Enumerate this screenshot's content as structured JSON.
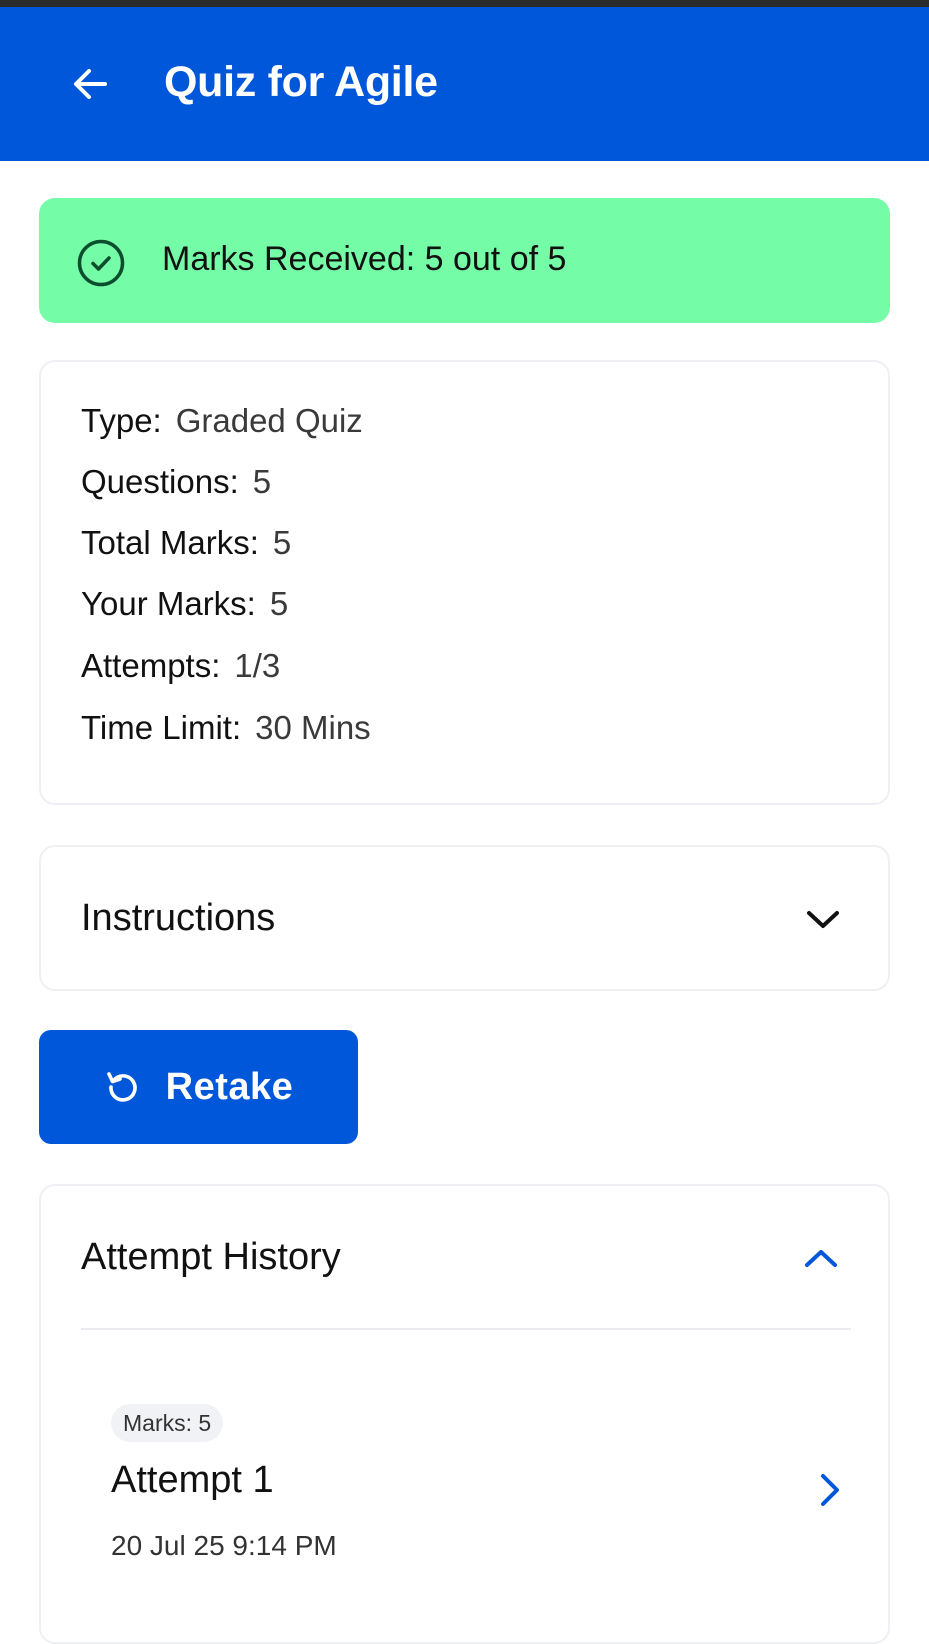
{
  "header": {
    "title": "Quiz for Agile",
    "back_icon": "arrow-left-icon",
    "background": "#0057d9"
  },
  "banner": {
    "text": "Marks Received: 5 out of 5",
    "icon": "check-circle-icon",
    "background": "#75fca6"
  },
  "details": {
    "rows": [
      {
        "label": "Type:",
        "value": "Graded Quiz"
      },
      {
        "label": "Questions:",
        "value": "5"
      },
      {
        "label": "Total Marks:",
        "value": "5"
      },
      {
        "label": "Your Marks:",
        "value": "5"
      },
      {
        "label": "Attempts:",
        "value": "1/3"
      },
      {
        "label": "Time Limit:",
        "value": "30 Mins"
      }
    ]
  },
  "instructions": {
    "title": "Instructions",
    "icon": "chevron-down-icon"
  },
  "retake": {
    "label": "Retake",
    "icon": "retake-icon"
  },
  "history": {
    "title": "Attempt History",
    "icon": "chevron-up-icon",
    "attempts": [
      {
        "badge": "Marks: 5",
        "name": "Attempt 1",
        "date": "20 Jul 25 9:14 PM",
        "icon": "chevron-right-icon"
      }
    ]
  }
}
